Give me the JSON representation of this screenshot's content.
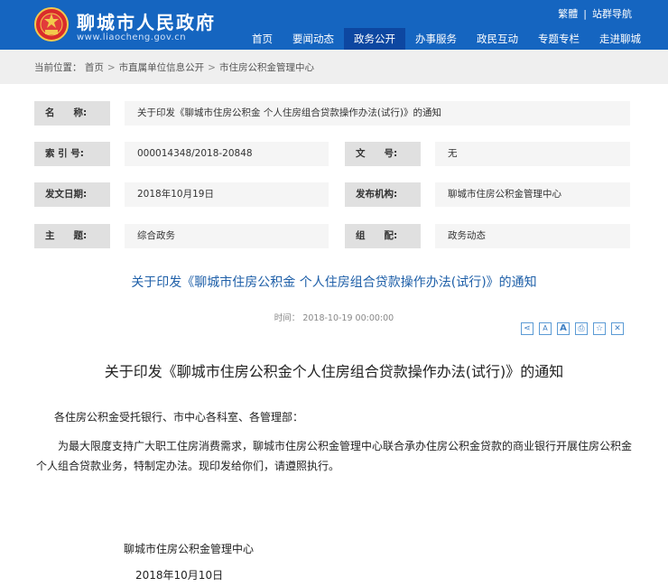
{
  "header": {
    "site_name": "聊城市人民政府",
    "site_url": "www.liaocheng.gov.cn",
    "top_links": [
      "繁體",
      "站群导航"
    ],
    "nav": [
      "首页",
      "要闻动态",
      "政务公开",
      "办事服务",
      "政民互动",
      "专题专栏",
      "走进聊城"
    ],
    "active_nav": "政务公开",
    "colors": {
      "primary": "#1565c0",
      "active": "#0d47a1"
    }
  },
  "breadcrumb": {
    "prefix": "当前位置：",
    "items": [
      "首页",
      "市直属单位信息公开",
      "市住房公积金管理中心"
    ]
  },
  "meta": {
    "name_label": "名　　称:",
    "name_value": "关于印发《聊城市住房公积金 个人住房组合贷款操作办法(试行)》的通知",
    "index_label": "索 引 号:",
    "index_value": "000014348/2018-20848",
    "docno_label": "文　　号:",
    "docno_value": "无",
    "date_label": "发文日期:",
    "date_value": "2018年10月19日",
    "org_label": "发布机构:",
    "org_value": "聊城市住房公积金管理中心",
    "topic_label": "主　　题:",
    "topic_value": "综合政务",
    "category_label": "组　　配:",
    "category_value": "政务动态"
  },
  "article": {
    "title": "关于印发《聊城市住房公积金 个人住房组合贷款操作办法(试行)》的通知",
    "time_label": "时间：",
    "time_value": "2018-10-19 00:00:00",
    "tools": [
      "share-icon",
      "font-decrease-icon",
      "font-increase-icon",
      "print-icon",
      "favorite-icon",
      "close-icon"
    ],
    "tool_glyphs": [
      "⋖",
      "A",
      "A",
      "⎙",
      "☆",
      "✕"
    ],
    "doc_title": "关于印发《聊城市住房公积金个人住房组合贷款操作办法(试行)》的通知",
    "salutation": "各住房公积金受托银行、市中心各科室、各管理部：",
    "body": "为最大限度支持广大职工住房消费需求，聊城市住房公积金管理中心联合承办住房公积金贷款的商业银行开展住房公积金个人组合贷款业务，特制定办法。现印发给你们，请遵照执行。",
    "signature": "聊城市住房公积金管理中心",
    "sign_date": "2018年10月10日"
  }
}
